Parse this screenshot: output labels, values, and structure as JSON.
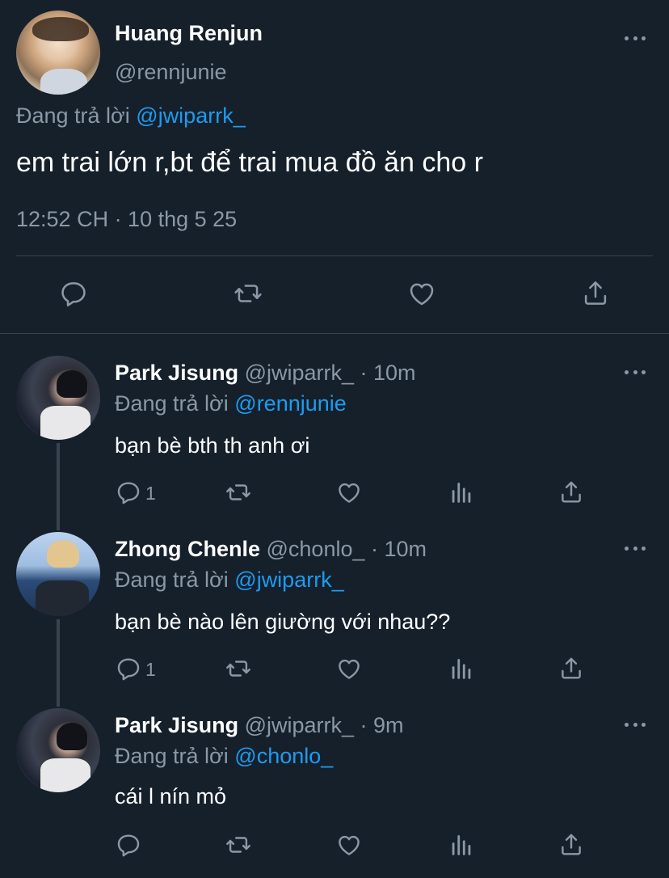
{
  "main_tweet": {
    "name": "Huang Renjun",
    "handle": "@rennjunie",
    "reply_prefix": "Đang trả lời",
    "reply_to": "@jwiparrk_",
    "text": "em trai lớn r,bt để trai mua đồ ăn cho r",
    "timestamp": "12:52 CH · 10 thg 5 25"
  },
  "replies": [
    {
      "name": "Park Jisung",
      "handle": "@jwiparrk_",
      "time": "· 10m",
      "reply_prefix": "Đang trả lời",
      "reply_to": "@rennjunie",
      "text": "bạn bè bth th anh ơi",
      "reply_count": "1"
    },
    {
      "name": "Zhong Chenle",
      "handle": "@chonlo_",
      "time": "· 10m",
      "reply_prefix": "Đang trả lời",
      "reply_to": "@jwiparrk_",
      "text": "bạn bè nào lên giường với nhau??",
      "reply_count": "1"
    },
    {
      "name": "Park Jisung",
      "handle": "@jwiparrk_",
      "time": "· 9m",
      "reply_prefix": "Đang trả lời",
      "reply_to": "@chonlo_",
      "text": "cái l nín mỏ",
      "reply_count": ""
    }
  ],
  "colors": {
    "background": "#15202b",
    "text": "#ffffff",
    "muted": "#8b98a5",
    "link": "#1d9bf0",
    "divider": "#38444d"
  }
}
